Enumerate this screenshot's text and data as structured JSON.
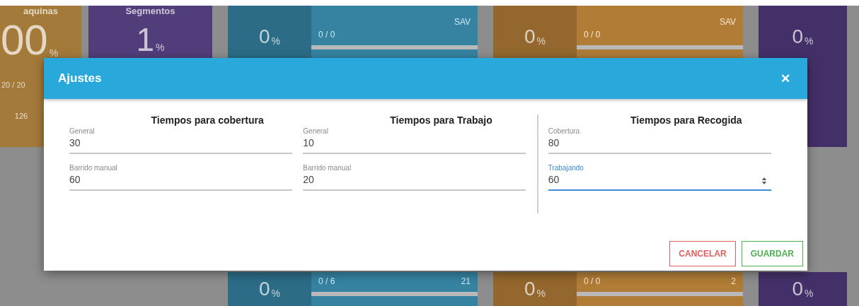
{
  "dashboard": {
    "top_tiles": [
      {
        "kind": "stat",
        "color": "#a47a3a",
        "label": "aquinas",
        "value": "00",
        "unit": "%",
        "count": "20 / 20",
        "extra": "126"
      },
      {
        "kind": "stat",
        "color": "#523d7b",
        "label": "Segmentos",
        "value": "1",
        "unit": "%"
      },
      {
        "kind": "pair",
        "color": "#2c6c86",
        "value": "0",
        "unit": "%",
        "count": "0 / 0",
        "tag": "SAV"
      },
      {
        "kind": "pair",
        "color": "#93672d",
        "value": "0",
        "unit": "%",
        "count": "0 / 0",
        "tag": "SAV"
      },
      {
        "kind": "single",
        "color": "#443068",
        "value": "0",
        "unit": "%"
      }
    ],
    "bottom_tiles": [
      {
        "kind": "pair",
        "color": "#2c6c86",
        "value": "0",
        "unit": "%",
        "count": "0 / 6",
        "tag": "21"
      },
      {
        "kind": "pair",
        "color": "#93672d",
        "value": "0",
        "unit": "%",
        "count": "0 / 0",
        "tag": "2"
      },
      {
        "kind": "single",
        "color": "#443068",
        "value": "0",
        "unit": "%"
      }
    ]
  },
  "dialog": {
    "title": "Ajustes",
    "close": "✕",
    "columns": [
      {
        "title": "Tiempos para cobertura",
        "fields": [
          {
            "label": "General",
            "value": "30",
            "focused": false
          },
          {
            "label": "Barrido manual",
            "value": "60",
            "focused": false
          }
        ]
      },
      {
        "title": "Tiempos para Trabajo",
        "fields": [
          {
            "label": "General",
            "value": "10",
            "focused": false
          },
          {
            "label": "Barrido manual",
            "value": "20",
            "focused": false
          }
        ]
      },
      {
        "title": "Tiempos para Recogida",
        "fields": [
          {
            "label": "Cobertura",
            "value": "80",
            "focused": false
          },
          {
            "label": "Trabajando",
            "value": "60",
            "focused": true
          }
        ]
      }
    ],
    "buttons": [
      {
        "label": "CANCELAR",
        "kind": "cancel"
      },
      {
        "label": "GUARDAR",
        "kind": "save"
      }
    ]
  }
}
